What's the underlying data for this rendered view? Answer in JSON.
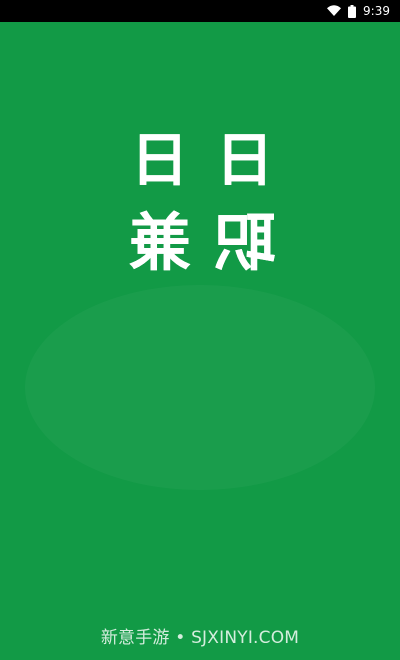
{
  "status_bar": {
    "time": "9:39",
    "wifi_icon": "wifi-icon",
    "battery_icon": "battery-icon"
  },
  "splash": {
    "background_color": "#129a46",
    "logo_chars": [
      "日",
      "日",
      "兼",
      "职"
    ],
    "watermark": "新意手游 • SJXINYI.COM"
  }
}
